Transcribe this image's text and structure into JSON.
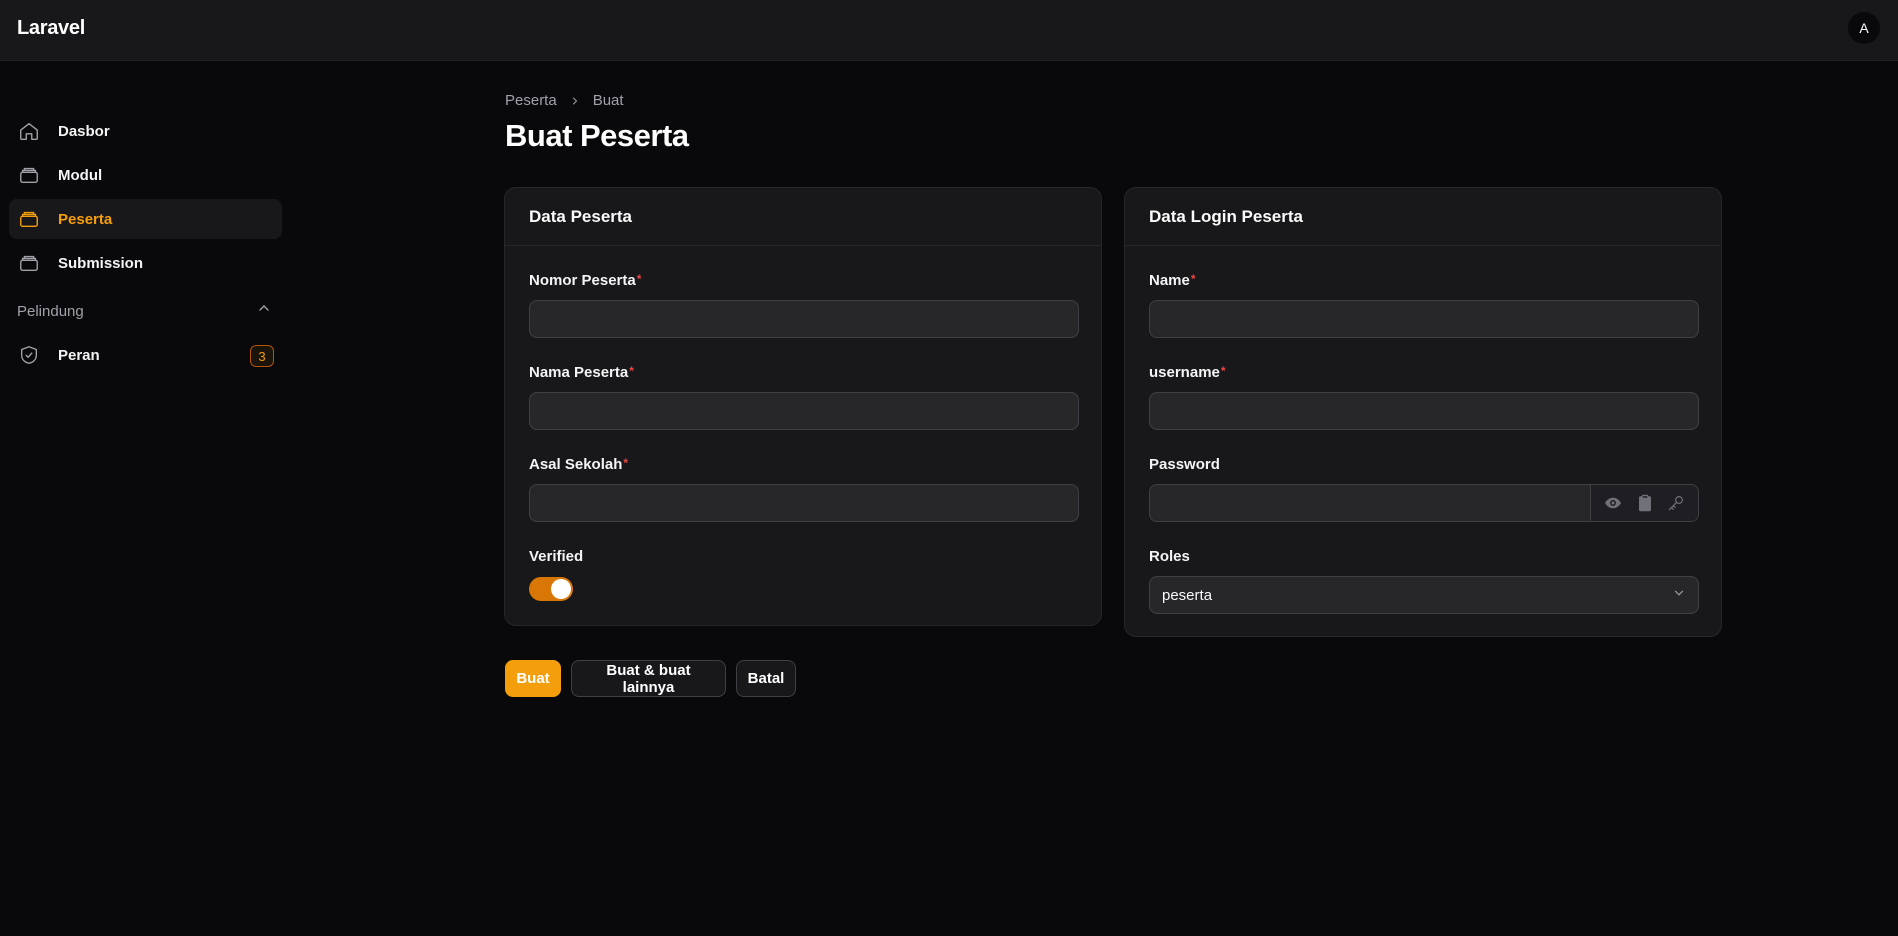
{
  "app": {
    "brand": "Laravel",
    "avatar_initial": "A"
  },
  "sidebar": {
    "items": [
      {
        "label": "Dasbor",
        "icon": "home-icon"
      },
      {
        "label": "Modul",
        "icon": "stack-icon"
      },
      {
        "label": "Peserta",
        "icon": "stack-icon",
        "active": true
      },
      {
        "label": "Submission",
        "icon": "stack-icon"
      }
    ],
    "group": {
      "label": "Pelindung",
      "items": [
        {
          "label": "Peran",
          "icon": "shield-check-icon",
          "badge": "3"
        }
      ]
    }
  },
  "breadcrumb": {
    "items": [
      "Peserta",
      "Buat"
    ]
  },
  "page": {
    "title": "Buat Peserta"
  },
  "card_peserta": {
    "title": "Data Peserta",
    "fields": {
      "nomor": {
        "label": "Nomor Peserta",
        "required_mark": "*",
        "value": ""
      },
      "nama": {
        "label": "Nama Peserta",
        "required_mark": "*",
        "value": ""
      },
      "asal": {
        "label": "Asal Sekolah",
        "required_mark": "*",
        "value": ""
      },
      "verified": {
        "label": "Verified",
        "on": true
      }
    }
  },
  "card_login": {
    "title": "Data Login Peserta",
    "fields": {
      "name": {
        "label": "Name",
        "required_mark": "*",
        "value": ""
      },
      "username": {
        "label": "username",
        "required_mark": "*",
        "value": ""
      },
      "password": {
        "label": "Password",
        "value": ""
      },
      "roles": {
        "label": "Roles",
        "selected": "peserta"
      }
    }
  },
  "actions": {
    "create": "Buat",
    "create_another": "Buat & buat lainnya",
    "cancel": "Batal"
  },
  "colors": {
    "accent": "#f59e0b",
    "background": "#09090b",
    "surface": "#18181b",
    "required": "#ef4444"
  }
}
